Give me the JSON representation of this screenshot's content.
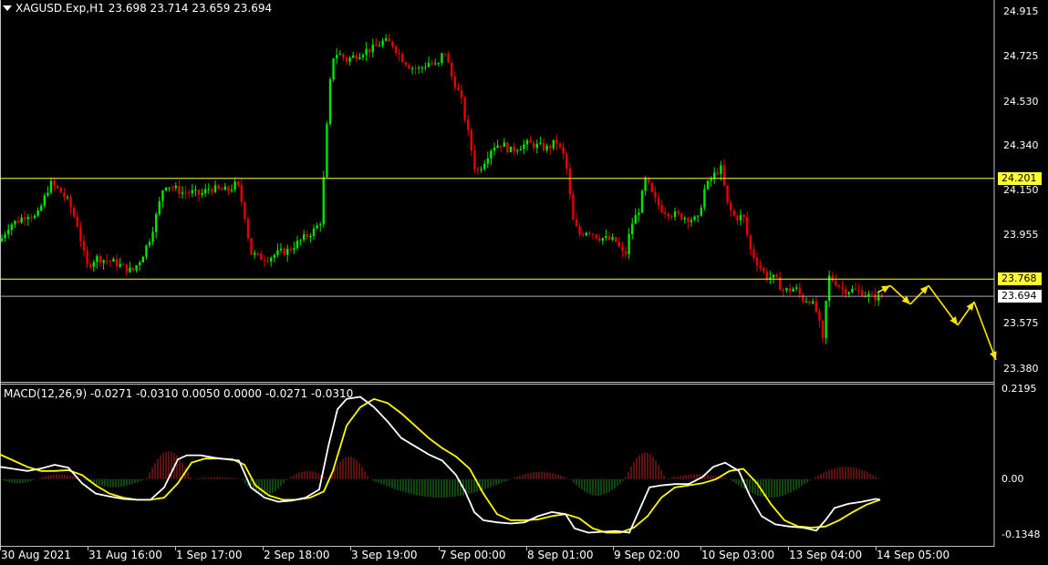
{
  "header": {
    "symbol": "XAGUSD.Exp,H1",
    "ohlc": "23.698 23.714 23.659 23.694"
  },
  "macd": {
    "label": "MACD(12,26,9) -0.0271 -0.0310 0.0050 0.0000 -0.0271 -0.0310"
  },
  "price_axis": [
    "24.915",
    "24.725",
    "24.530",
    "24.340",
    "24.150",
    "23.955",
    "23.575",
    "23.380"
  ],
  "macd_axis": [
    "0.2195",
    "0.00",
    "-0.1348"
  ],
  "levels": {
    "resistance": "24.201",
    "support": "23.768",
    "current": "23.694"
  },
  "time_axis": [
    "30 Aug 2021",
    "31 Aug 16:00",
    "1 Sep 17:00",
    "2 Sep 18:00",
    "3 Sep 19:00",
    "7 Sep 00:00",
    "8 Sep 01:00",
    "9 Sep 02:00",
    "10 Sep 03:00",
    "13 Sep 04:00",
    "14 Sep 05:00"
  ],
  "colors": {
    "bull": "#00e600",
    "bear": "#e60000",
    "level": "#ffff33",
    "forecast": "#ffe600",
    "macd_main": "#ffffff",
    "macd_signal": "#ffff00",
    "hist_pos": "#b22222",
    "hist_neg": "#228b22",
    "grid": "#c0c0c0"
  },
  "chart_data": {
    "type": "candlestick",
    "price_ylim": [
      23.33,
      24.96
    ],
    "macd_ylim": [
      -0.16,
      0.23
    ],
    "close_path": [
      [
        0,
        23.93
      ],
      [
        10,
        24.0
      ],
      [
        20,
        24.02
      ],
      [
        30,
        24.05
      ],
      [
        40,
        24.03
      ],
      [
        55,
        24.18
      ],
      [
        65,
        24.15
      ],
      [
        75,
        24.1
      ],
      [
        85,
        24.0
      ],
      [
        95,
        23.82
      ],
      [
        105,
        23.86
      ],
      [
        115,
        23.85
      ],
      [
        125,
        23.84
      ],
      [
        135,
        23.82
      ],
      [
        145,
        23.8
      ],
      [
        155,
        23.86
      ],
      [
        165,
        23.95
      ],
      [
        172,
        24.05
      ],
      [
        180,
        24.18
      ],
      [
        190,
        24.16
      ],
      [
        200,
        24.14
      ],
      [
        210,
        24.14
      ],
      [
        220,
        24.13
      ],
      [
        230,
        24.16
      ],
      [
        240,
        24.15
      ],
      [
        250,
        24.15
      ],
      [
        260,
        24.18
      ],
      [
        268,
        24.05
      ],
      [
        275,
        23.88
      ],
      [
        285,
        23.86
      ],
      [
        295,
        23.86
      ],
      [
        305,
        23.88
      ],
      [
        315,
        23.89
      ],
      [
        325,
        23.92
      ],
      [
        335,
        23.95
      ],
      [
        345,
        23.98
      ],
      [
        352,
        24.02
      ],
      [
        358,
        24.4
      ],
      [
        364,
        24.72
      ],
      [
        370,
        24.74
      ],
      [
        380,
        24.71
      ],
      [
        390,
        24.73
      ],
      [
        400,
        24.75
      ],
      [
        410,
        24.76
      ],
      [
        420,
        24.79
      ],
      [
        430,
        24.78
      ],
      [
        440,
        24.72
      ],
      [
        450,
        24.68
      ],
      [
        460,
        24.67
      ],
      [
        470,
        24.7
      ],
      [
        480,
        24.68
      ],
      [
        487,
        24.76
      ],
      [
        495,
        24.64
      ],
      [
        505,
        24.55
      ],
      [
        515,
        24.36
      ],
      [
        522,
        24.22
      ],
      [
        530,
        24.27
      ],
      [
        540,
        24.34
      ],
      [
        550,
        24.35
      ],
      [
        560,
        24.32
      ],
      [
        570,
        24.34
      ],
      [
        580,
        24.35
      ],
      [
        590,
        24.34
      ],
      [
        600,
        24.33
      ],
      [
        610,
        24.36
      ],
      [
        620,
        24.28
      ],
      [
        628,
        24.02
      ],
      [
        635,
        23.96
      ],
      [
        645,
        23.98
      ],
      [
        655,
        23.95
      ],
      [
        665,
        23.94
      ],
      [
        675,
        23.93
      ],
      [
        685,
        23.86
      ],
      [
        692,
        24.0
      ],
      [
        700,
        24.06
      ],
      [
        708,
        24.2
      ],
      [
        716,
        24.12
      ],
      [
        725,
        24.07
      ],
      [
        735,
        24.05
      ],
      [
        745,
        24.04
      ],
      [
        755,
        24.03
      ],
      [
        765,
        24.02
      ],
      [
        772,
        24.15
      ],
      [
        780,
        24.2
      ],
      [
        790,
        24.25
      ],
      [
        798,
        24.08
      ],
      [
        806,
        24.03
      ],
      [
        815,
        24.04
      ],
      [
        822,
        23.9
      ],
      [
        830,
        23.84
      ],
      [
        840,
        23.78
      ],
      [
        850,
        23.77
      ],
      [
        858,
        23.72
      ],
      [
        865,
        23.72
      ],
      [
        872,
        23.73
      ],
      [
        880,
        23.68
      ],
      [
        888,
        23.68
      ],
      [
        896,
        23.62
      ],
      [
        902,
        23.5
      ],
      [
        908,
        23.78
      ],
      [
        915,
        23.76
      ],
      [
        925,
        23.72
      ],
      [
        935,
        23.72
      ],
      [
        945,
        23.71
      ],
      [
        955,
        23.69
      ],
      [
        965,
        23.69
      ],
      [
        970,
        23.694
      ]
    ],
    "macd_main_path": [
      [
        0,
        0.03
      ],
      [
        15,
        0.025
      ],
      [
        30,
        0.02
      ],
      [
        45,
        0.026
      ],
      [
        60,
        0.035
      ],
      [
        75,
        0.028
      ],
      [
        90,
        -0.01
      ],
      [
        105,
        -0.035
      ],
      [
        120,
        -0.042
      ],
      [
        135,
        -0.048
      ],
      [
        150,
        -0.05
      ],
      [
        165,
        -0.05
      ],
      [
        180,
        -0.02
      ],
      [
        195,
        0.048
      ],
      [
        205,
        0.058
      ],
      [
        220,
        0.058
      ],
      [
        235,
        0.052
      ],
      [
        250,
        0.048
      ],
      [
        262,
        0.045
      ],
      [
        275,
        -0.02
      ],
      [
        290,
        -0.045
      ],
      [
        305,
        -0.055
      ],
      [
        320,
        -0.052
      ],
      [
        335,
        -0.045
      ],
      [
        350,
        -0.025
      ],
      [
        360,
        0.08
      ],
      [
        370,
        0.17
      ],
      [
        380,
        0.195
      ],
      [
        395,
        0.2
      ],
      [
        410,
        0.175
      ],
      [
        425,
        0.14
      ],
      [
        440,
        0.1
      ],
      [
        455,
        0.08
      ],
      [
        470,
        0.06
      ],
      [
        485,
        0.045
      ],
      [
        500,
        0.01
      ],
      [
        510,
        -0.03
      ],
      [
        520,
        -0.08
      ],
      [
        530,
        -0.1
      ],
      [
        545,
        -0.105
      ],
      [
        560,
        -0.108
      ],
      [
        575,
        -0.105
      ],
      [
        590,
        -0.09
      ],
      [
        605,
        -0.08
      ],
      [
        620,
        -0.085
      ],
      [
        630,
        -0.12
      ],
      [
        645,
        -0.13
      ],
      [
        660,
        -0.128
      ],
      [
        675,
        -0.126
      ],
      [
        690,
        -0.13
      ],
      [
        700,
        -0.08
      ],
      [
        712,
        -0.02
      ],
      [
        725,
        -0.015
      ],
      [
        740,
        -0.012
      ],
      [
        755,
        -0.012
      ],
      [
        770,
        0.005
      ],
      [
        782,
        0.03
      ],
      [
        795,
        0.04
      ],
      [
        810,
        0.02
      ],
      [
        822,
        -0.04
      ],
      [
        835,
        -0.09
      ],
      [
        850,
        -0.11
      ],
      [
        865,
        -0.115
      ],
      [
        880,
        -0.118
      ],
      [
        895,
        -0.125
      ],
      [
        905,
        -0.1
      ],
      [
        915,
        -0.07
      ],
      [
        930,
        -0.06
      ],
      [
        945,
        -0.055
      ],
      [
        960,
        -0.048
      ],
      [
        965,
        -0.05
      ]
    ],
    "macd_signal_path": [
      [
        0,
        0.06
      ],
      [
        15,
        0.045
      ],
      [
        30,
        0.03
      ],
      [
        45,
        0.02
      ],
      [
        60,
        0.02
      ],
      [
        75,
        0.022
      ],
      [
        90,
        0.01
      ],
      [
        105,
        -0.015
      ],
      [
        120,
        -0.035
      ],
      [
        135,
        -0.045
      ],
      [
        150,
        -0.05
      ],
      [
        165,
        -0.05
      ],
      [
        180,
        -0.045
      ],
      [
        195,
        -0.01
      ],
      [
        210,
        0.04
      ],
      [
        225,
        0.05
      ],
      [
        240,
        0.05
      ],
      [
        255,
        0.048
      ],
      [
        268,
        0.035
      ],
      [
        280,
        -0.015
      ],
      [
        295,
        -0.04
      ],
      [
        310,
        -0.05
      ],
      [
        325,
        -0.05
      ],
      [
        340,
        -0.045
      ],
      [
        355,
        -0.03
      ],
      [
        365,
        0.02
      ],
      [
        380,
        0.13
      ],
      [
        395,
        0.175
      ],
      [
        410,
        0.195
      ],
      [
        425,
        0.185
      ],
      [
        440,
        0.16
      ],
      [
        455,
        0.13
      ],
      [
        470,
        0.1
      ],
      [
        485,
        0.075
      ],
      [
        500,
        0.055
      ],
      [
        515,
        0.025
      ],
      [
        530,
        -0.035
      ],
      [
        545,
        -0.085
      ],
      [
        560,
        -0.1
      ],
      [
        575,
        -0.1
      ],
      [
        590,
        -0.098
      ],
      [
        605,
        -0.09
      ],
      [
        620,
        -0.085
      ],
      [
        635,
        -0.095
      ],
      [
        650,
        -0.12
      ],
      [
        665,
        -0.13
      ],
      [
        680,
        -0.13
      ],
      [
        695,
        -0.118
      ],
      [
        710,
        -0.09
      ],
      [
        725,
        -0.045
      ],
      [
        740,
        -0.02
      ],
      [
        755,
        -0.015
      ],
      [
        770,
        -0.01
      ],
      [
        785,
        0.0
      ],
      [
        800,
        0.02
      ],
      [
        815,
        0.025
      ],
      [
        830,
        -0.01
      ],
      [
        845,
        -0.06
      ],
      [
        860,
        -0.1
      ],
      [
        875,
        -0.115
      ],
      [
        890,
        -0.118
      ],
      [
        905,
        -0.115
      ],
      [
        920,
        -0.1
      ],
      [
        935,
        -0.08
      ],
      [
        950,
        -0.062
      ],
      [
        965,
        -0.05
      ]
    ],
    "hist_bumps": [
      {
        "from": 0,
        "to": 40,
        "peak": -0.01
      },
      {
        "from": 40,
        "to": 90,
        "peak": 0.012
      },
      {
        "from": 90,
        "to": 160,
        "peak": -0.02
      },
      {
        "from": 160,
        "to": 210,
        "peak": 0.068
      },
      {
        "from": 210,
        "to": 265,
        "peak": 0.005
      },
      {
        "from": 265,
        "to": 315,
        "peak": -0.04
      },
      {
        "from": 315,
        "to": 360,
        "peak": 0.02
      },
      {
        "from": 360,
        "to": 405,
        "peak": 0.055
      },
      {
        "from": 405,
        "to": 560,
        "peak": -0.045
      },
      {
        "from": 560,
        "to": 625,
        "peak": 0.018
      },
      {
        "from": 625,
        "to": 685,
        "peak": -0.04
      },
      {
        "from": 685,
        "to": 730,
        "peak": 0.065
      },
      {
        "from": 730,
        "to": 800,
        "peak": 0.012
      },
      {
        "from": 800,
        "to": 890,
        "peak": -0.045
      },
      {
        "from": 890,
        "to": 965,
        "peak": 0.03
      }
    ],
    "forecast_zigzag": [
      [
        962,
        23.71
      ],
      [
        976,
        23.74
      ],
      [
        998,
        23.66
      ],
      [
        1018,
        23.74
      ],
      [
        1050,
        23.57
      ],
      [
        1068,
        23.67
      ],
      [
        1092,
        23.42
      ]
    ]
  }
}
